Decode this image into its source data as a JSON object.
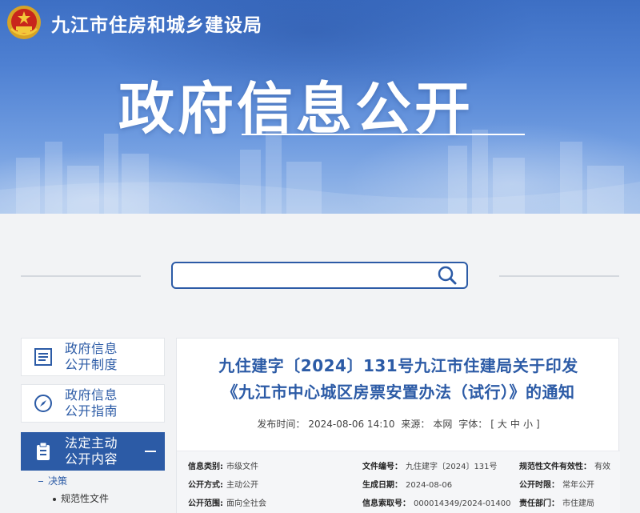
{
  "header": {
    "site_name": "九江市住房和城乡建设局",
    "banner_title": "政府信息公开"
  },
  "search": {
    "placeholder": "",
    "icon": "search-icon"
  },
  "sidebar": {
    "items": [
      {
        "label": "政府信息\n公开制度",
        "icon": "document-list-icon",
        "active": false
      },
      {
        "label": "政府信息\n公开指南",
        "icon": "compass-icon",
        "active": false
      },
      {
        "label": "法定主动\n公开内容",
        "icon": "clipboard-icon",
        "active": true
      }
    ],
    "sub_items": [
      {
        "label": "决策",
        "level": 1
      },
      {
        "label": "规范性文件",
        "level": 2
      }
    ]
  },
  "article": {
    "title_line1": "九住建字〔2024〕131号九江市住建局关于印发",
    "title_line2": "《九江市中心城区房票安置办法（试行）》的通知",
    "meta": {
      "publish_label": "发布时间：",
      "publish_value": "2024-08-06 14:10",
      "source_label": "来源：",
      "source_value": "本网",
      "font_label": "字体：",
      "font_open": "[",
      "font_large": "大",
      "font_medium": "中",
      "font_small": "小",
      "font_close": "]"
    },
    "info": [
      {
        "key": "信息类别:",
        "value": "市级文件"
      },
      {
        "key": "文件编号：",
        "value": "九住建字〔2024〕131号"
      },
      {
        "key": "规范性文件有效性：",
        "value": "有效"
      },
      {
        "key": "公开方式:",
        "value": "主动公开"
      },
      {
        "key": "生成日期：",
        "value": "2024-08-06"
      },
      {
        "key": "公开时限：",
        "value": "常年公开"
      },
      {
        "key": "公开范围:",
        "value": "面向全社会"
      },
      {
        "key": "信息索取号：",
        "value": "000014349/2024-01400"
      },
      {
        "key": "责任部门：",
        "value": "市住建局"
      }
    ]
  }
}
